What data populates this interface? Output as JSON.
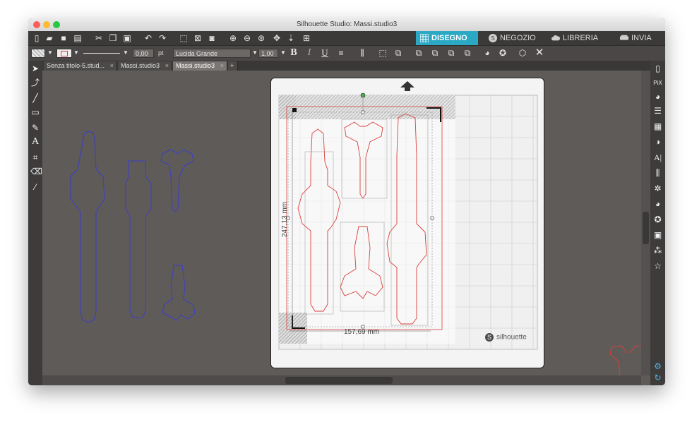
{
  "window": {
    "title": "Silhouette Studio: Massi.studio3"
  },
  "nav_tabs": [
    {
      "label": "DISEGNO",
      "icon": "grid-icon",
      "active": true
    },
    {
      "label": "NEGOZIO",
      "icon": "s-icon",
      "active": false
    },
    {
      "label": "LIBRERIA",
      "icon": "cloud-icon",
      "active": false
    },
    {
      "label": "INVIA",
      "icon": "cutter-icon",
      "active": false
    }
  ],
  "format_bar": {
    "line_width": "0,00",
    "line_unit": "pt",
    "font_name": "Lucida Grande",
    "font_size": "1,00",
    "bold_label": "B",
    "italic_label": "I",
    "underline_label": "U"
  },
  "doc_tabs": [
    {
      "label": "Senza titolo-5.stud...",
      "close": "×",
      "active": false
    },
    {
      "label": "Massi.studio3",
      "close": "×",
      "active": false
    },
    {
      "label": "Massi.studio3",
      "close": "×",
      "active": true
    }
  ],
  "add_tab_label": "+",
  "mat": {
    "height_label": "247,13 mm",
    "width_label": "157,69 mm",
    "brand": "silhouette"
  },
  "colors": {
    "accent": "#2aa8c4",
    "cut_line": "#d8403a",
    "outline_blue": "#3b3ec8",
    "canvas": "#5f5b59"
  }
}
